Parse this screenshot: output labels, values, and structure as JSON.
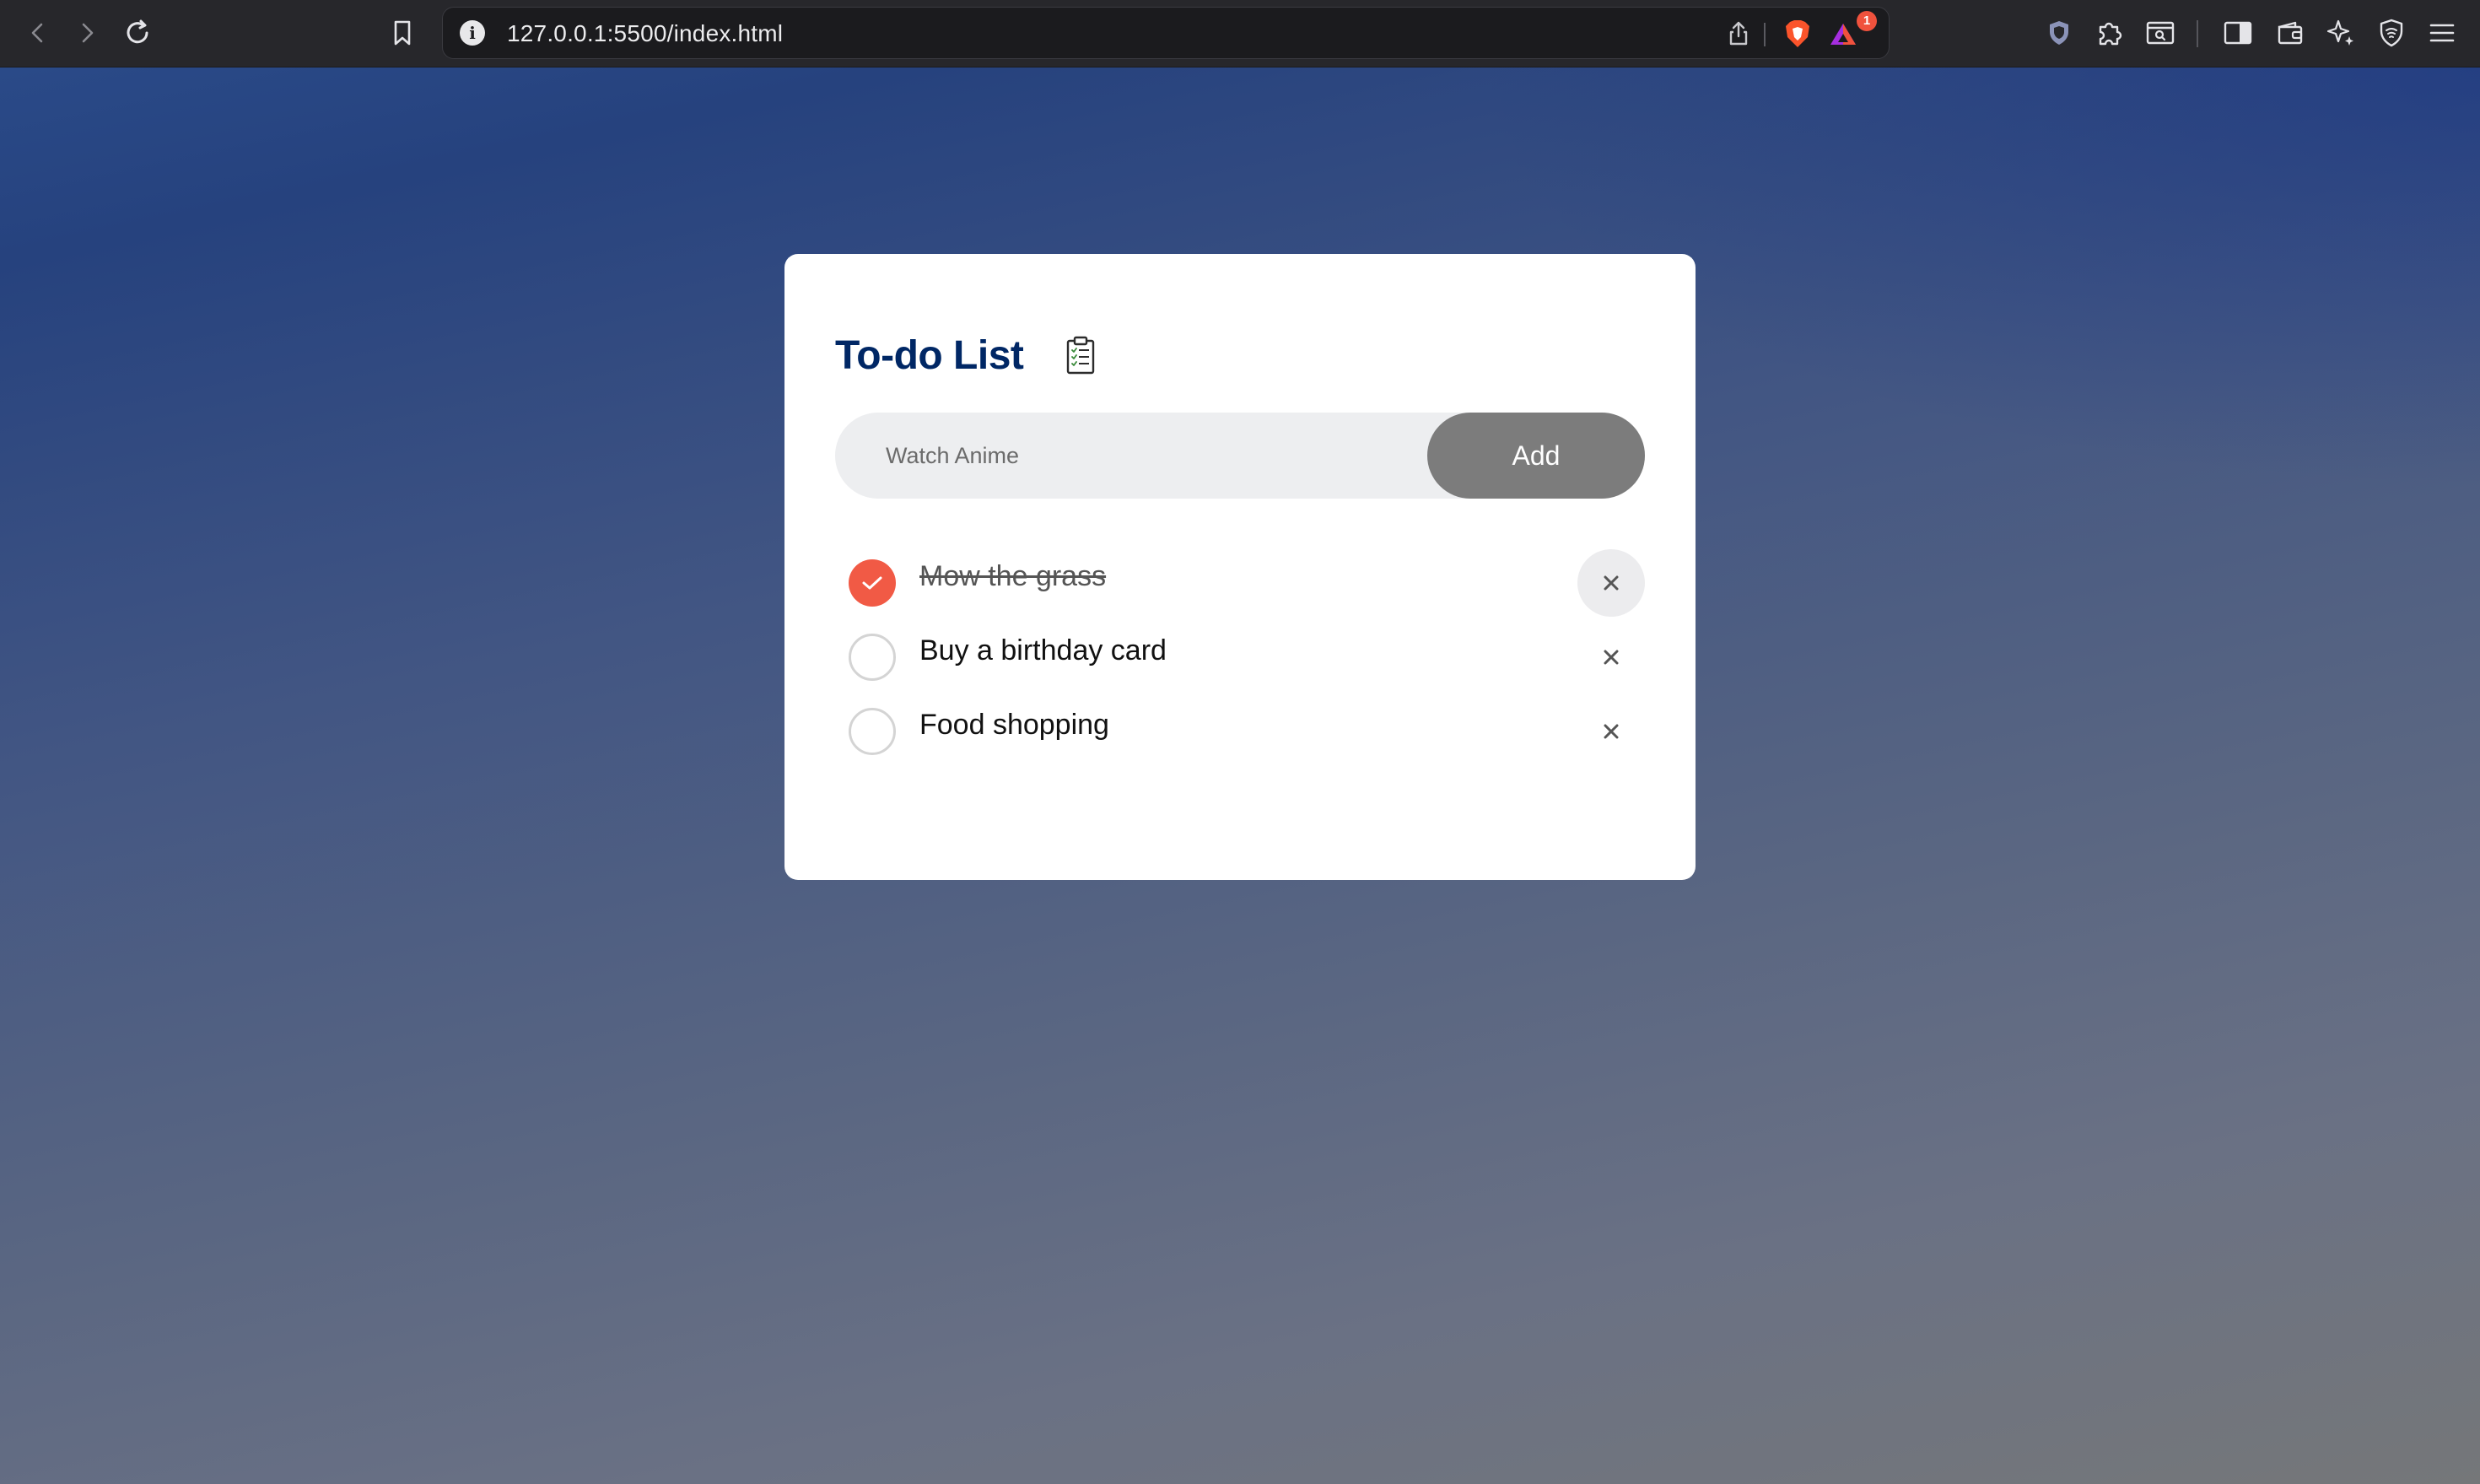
{
  "browser": {
    "url": "127.0.0.1:5500/index.html",
    "notification_count": "1",
    "icons": [
      "back-icon",
      "forward-icon",
      "reload-icon",
      "bookmark-icon",
      "site-info-icon",
      "share-icon",
      "brave-shields-icon",
      "brave-rewards-icon",
      "vpn-icon",
      "extensions-icon",
      "search-page-icon",
      "sidebar-icon",
      "wallet-icon",
      "leo-ai-icon",
      "shield-icon",
      "menu-icon"
    ]
  },
  "todo": {
    "title": "To-do List",
    "title_icon": "clipboard-icon",
    "input_placeholder": "Watch Anime",
    "add_label": "Add",
    "tasks": [
      {
        "label": "Mow the grass",
        "done": true
      },
      {
        "label": "Buy a birthday card",
        "done": false
      },
      {
        "label": "Food shopping",
        "done": false
      }
    ]
  },
  "colors": {
    "title": "#002765",
    "check_accent": "#f15a45",
    "add_button": "#7c7c7c",
    "input_bg": "#edeef0"
  }
}
